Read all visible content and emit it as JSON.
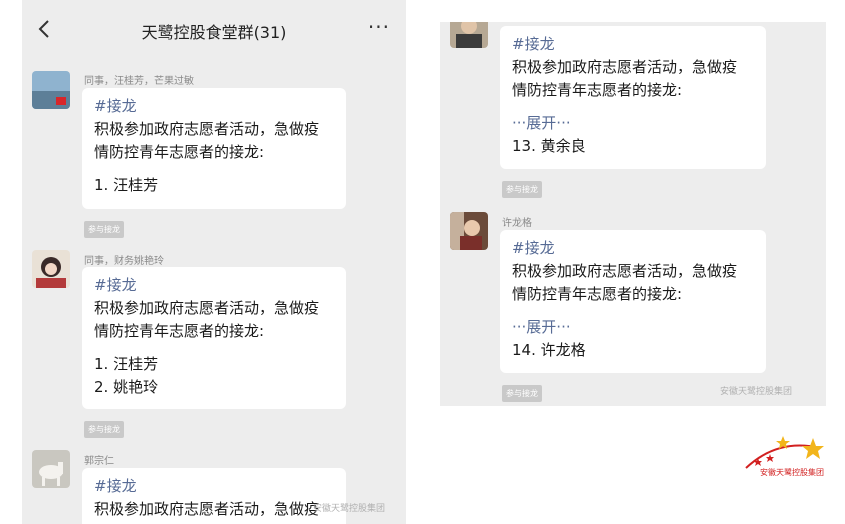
{
  "header": {
    "title": "天鹭控股食堂群(31)",
    "more_label": "···"
  },
  "left_messages": [
    {
      "sender": "同事，汪桂芳，芒果过敏",
      "tag": "#接龙",
      "text": "积极参加政府志愿者活动，急做疫\n情防控青年志愿者的接龙:",
      "entries": [
        "1. 汪桂芳"
      ],
      "join_label": "参与接龙"
    },
    {
      "sender": "同事，财务姚艳玲",
      "tag": "#接龙",
      "text": "积极参加政府志愿者活动，急做疫\n情防控青年志愿者的接龙:",
      "entries": [
        "1. 汪桂芳",
        "2. 姚艳玲"
      ],
      "join_label": "参与接龙"
    },
    {
      "sender": "郭宗仁",
      "tag": "#接龙",
      "text": "积极参加政府志愿者活动，急做疫\n情防控青年志愿者的接龙:"
    }
  ],
  "right_messages": [
    {
      "tag": "#接龙",
      "text": "积极参加政府志愿者活动，急做疫\n情防控青年志愿者的接龙:",
      "expand_label": "···展开···",
      "entry": "13. 黄余良",
      "join_label": "参与接龙"
    },
    {
      "sender": "许龙格",
      "tag": "#接龙",
      "text": "积极参加政府志愿者活动，急做疫\n情防控青年志愿者的接龙:",
      "expand_label": "···展开···",
      "entry": "14. 许龙格",
      "join_label": "参与接龙"
    }
  ],
  "watermark_left": "安徽天鹭控股集团",
  "watermark_right": "安徽天鹭控股集团",
  "logo_text": "安徽天鹭控股集团",
  "colors": {
    "link": "#576b95",
    "background": "#ededed",
    "bubble": "#ffffff",
    "logo_red": "#d22020",
    "logo_star": "#f2b51b"
  },
  "icons": {
    "back": "chevron-left-icon",
    "more": "more-dots-icon"
  }
}
